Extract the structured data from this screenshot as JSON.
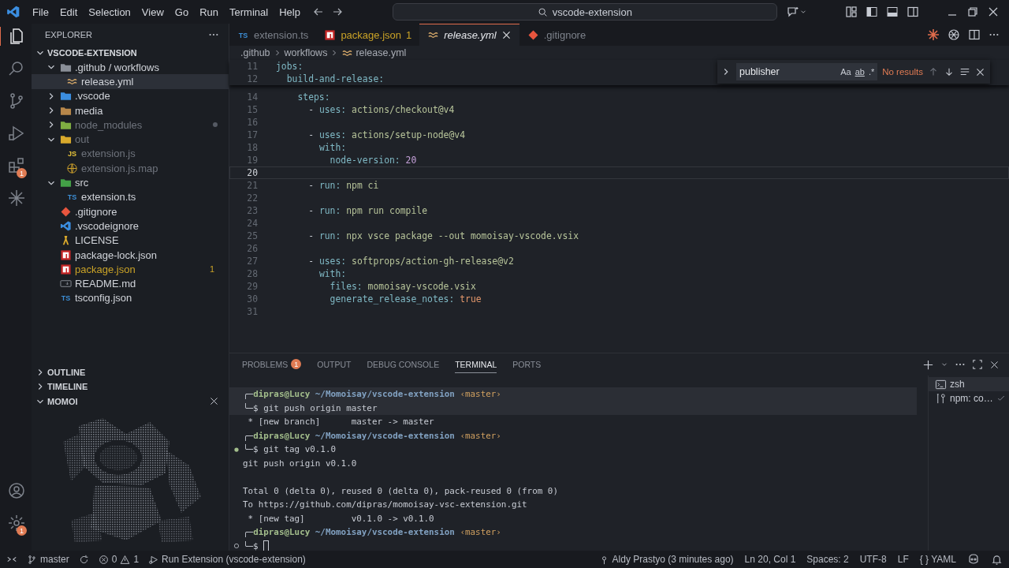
{
  "title_bar": {
    "menus": [
      "File",
      "Edit",
      "Selection",
      "View",
      "Go",
      "Run",
      "Terminal",
      "Help"
    ],
    "command_center": "vscode-extension"
  },
  "activity_bar": {
    "items": [
      {
        "kind": "explorer",
        "selected": true
      },
      {
        "kind": "search",
        "selected": false
      },
      {
        "kind": "source-control",
        "selected": false
      },
      {
        "kind": "run",
        "selected": false
      },
      {
        "kind": "extensions",
        "selected": false,
        "badge": "1"
      },
      {
        "kind": "sparkle",
        "selected": false
      }
    ],
    "bottom": [
      {
        "kind": "account"
      },
      {
        "kind": "settings",
        "badge": "1"
      }
    ]
  },
  "sidebar": {
    "title": "EXPLORER",
    "root": {
      "label": "VSCODE-EXTENSION",
      "expanded": true,
      "children": [
        {
          "label": ".github / workflows",
          "kind": "folder-github",
          "expanded": true,
          "selected": false,
          "ignored": false,
          "warning": false,
          "children": [
            {
              "label": "release.yml",
              "kind": "yaml",
              "selected": true,
              "ignored": false,
              "warning": false
            }
          ]
        },
        {
          "label": ".vscode",
          "kind": "folder-vscode",
          "expanded": false,
          "selected": false,
          "ignored": false,
          "warning": false
        },
        {
          "label": "media",
          "kind": "folder",
          "expanded": false,
          "selected": false,
          "ignored": false,
          "warning": false
        },
        {
          "label": "node_modules",
          "kind": "folder-node",
          "expanded": false,
          "selected": false,
          "ignored": true,
          "warning": false
        },
        {
          "label": "out",
          "kind": "folder-out",
          "expanded": true,
          "selected": false,
          "ignored": true,
          "warning": false,
          "children": [
            {
              "label": "extension.js",
              "kind": "js",
              "icon_text": "JS",
              "selected": false,
              "ignored": true,
              "warning": false
            },
            {
              "label": "extension.js.map",
              "kind": "globe",
              "selected": false,
              "ignored": true,
              "warning": false
            }
          ]
        },
        {
          "label": "src",
          "kind": "folder-src",
          "expanded": true,
          "selected": false,
          "ignored": false,
          "warning": false,
          "children": [
            {
              "label": "extension.ts",
              "kind": "ts",
              "icon_text": "TS",
              "selected": false,
              "ignored": false,
              "warning": false
            }
          ]
        },
        {
          "label": ".gitignore",
          "kind": "git",
          "selected": false,
          "ignored": false,
          "warning": false
        },
        {
          "label": ".vscodeignore",
          "kind": "vscode",
          "selected": false,
          "ignored": false,
          "warning": false
        },
        {
          "label": "LICENSE",
          "kind": "license",
          "selected": false,
          "ignored": false,
          "warning": false
        },
        {
          "label": "package-lock.json",
          "kind": "npm",
          "selected": false,
          "ignored": false,
          "warning": false
        },
        {
          "label": "package.json",
          "kind": "npm",
          "selected": false,
          "ignored": false,
          "warning": true,
          "badge": "1"
        },
        {
          "label": "README.md",
          "kind": "markdown",
          "selected": false,
          "ignored": false,
          "warning": false
        },
        {
          "label": "tsconfig.json",
          "kind": "tsconfig",
          "icon_text": "TS",
          "selected": false,
          "ignored": false,
          "warning": false
        }
      ]
    },
    "sections": [
      {
        "label": "OUTLINE",
        "expanded": false
      },
      {
        "label": "TIMELINE",
        "expanded": false
      },
      {
        "label": "MOMOI",
        "expanded": true
      }
    ]
  },
  "editor": {
    "tabs": [
      {
        "label": "extension.ts",
        "kind": "ts",
        "icon_text": "TS",
        "selected": false,
        "preview": false,
        "warning": false
      },
      {
        "label": "package.json",
        "kind": "npm",
        "selected": false,
        "preview": false,
        "warning": true,
        "badge": "1"
      },
      {
        "label": "release.yml",
        "kind": "yaml",
        "selected": true,
        "preview": true,
        "warning": false
      },
      {
        "label": ".gitignore",
        "kind": "git",
        "selected": false,
        "preview": false,
        "warning": false
      }
    ],
    "breadcrumbs": [
      ".github",
      "workflows",
      "release.yml"
    ],
    "sticky_lines": [
      {
        "number": "11",
        "key": "jobs:",
        "children": [
          {
            "number": "12",
            "key": "build-and-release:"
          }
        ]
      }
    ],
    "lines": [
      {
        "number": "14",
        "key": "steps:",
        "current": false,
        "children": [
          {
            "number": "15",
            "prefix": "-",
            "key": "uses:",
            "value": "actions/checkout@v4",
            "kind": "string",
            "current": false
          },
          {
            "number": "16",
            "current": false
          },
          {
            "number": "17",
            "prefix": "-",
            "key": "uses:",
            "value": "actions/setup-node@v4",
            "kind": "string",
            "current": false,
            "children": [
              {
                "number": "18",
                "key": "with:",
                "current": false,
                "children": [
                  {
                    "number": "19",
                    "key": "node-version:",
                    "value": "20",
                    "kind": "number",
                    "current": false
                  }
                ]
              }
            ]
          },
          {
            "number": "20",
            "current": true
          },
          {
            "number": "21",
            "prefix": "-",
            "key": "run:",
            "value": "npm ci",
            "kind": "string",
            "current": false
          },
          {
            "number": "22",
            "current": false
          },
          {
            "number": "23",
            "prefix": "-",
            "key": "run:",
            "value": "npm run compile",
            "kind": "string",
            "current": false
          },
          {
            "number": "24",
            "current": false
          },
          {
            "number": "25",
            "prefix": "-",
            "key": "run:",
            "value": "npx vsce package --out momoisay-vscode.vsix",
            "kind": "string",
            "current": false
          },
          {
            "number": "26",
            "current": false
          },
          {
            "number": "27",
            "prefix": "-",
            "key": "uses:",
            "value": "softprops/action-gh-release@v2",
            "kind": "string",
            "current": false,
            "children": [
              {
                "number": "28",
                "key": "with:",
                "current": false,
                "children": [
                  {
                    "number": "29",
                    "key": "files:",
                    "value": "momoisay-vscode.vsix",
                    "kind": "string",
                    "current": false
                  },
                  {
                    "number": "30",
                    "key": "generate_release_notes:",
                    "value": "true",
                    "kind": "boolean",
                    "current": false
                  }
                ]
              }
            ]
          }
        ]
      },
      {
        "number": "31",
        "current": false
      }
    ],
    "find": {
      "value": "publisher",
      "options": [
        "Aa",
        "ab",
        ".*"
      ],
      "status": "No results"
    }
  },
  "panel": {
    "tabs": [
      {
        "label": "PROBLEMS",
        "badge": "1",
        "selected": false
      },
      {
        "label": "OUTPUT",
        "selected": false
      },
      {
        "label": "DEBUG CONSOLE",
        "selected": false
      },
      {
        "label": "TERMINAL",
        "selected": true
      },
      {
        "label": "PORTS",
        "selected": false
      }
    ],
    "terminal": {
      "lines": [
        {
          "kind": "prompt",
          "corner": "╭─",
          "user": "dipras@Lucy",
          "path": "~/Momoisay/vscode-extension",
          "branch": "‹master›",
          "hovered": true
        },
        {
          "kind": "command",
          "corner": "╰─$",
          "text": "git push origin master",
          "decorated": false,
          "hovered": true
        },
        {
          "kind": "output",
          "text": " * [new branch]      master -> master",
          "hovered": false
        },
        {
          "kind": "prompt",
          "corner": "╭─",
          "user": "dipras@Lucy",
          "path": "~/Momoisay/vscode-extension",
          "branch": "‹master›",
          "hovered": false
        },
        {
          "kind": "command",
          "corner": "╰─$",
          "text": "git tag v0.1.0",
          "decorated": true,
          "succeeded": true,
          "hovered": false
        },
        {
          "kind": "output",
          "text": "git push origin v0.1.0",
          "hovered": false
        },
        {
          "kind": "blank",
          "hovered": false
        },
        {
          "kind": "output",
          "text": "Total 0 (delta 0), reused 0 (delta 0), pack-reused 0 (from 0)",
          "hovered": false
        },
        {
          "kind": "output",
          "text": "To https://github.com/dipras/momoisay-vsc-extension.git",
          "hovered": false
        },
        {
          "kind": "output",
          "text": " * [new tag]         v0.1.0 -> v0.1.0",
          "hovered": false
        },
        {
          "kind": "prompt",
          "corner": "╭─",
          "user": "dipras@Lucy",
          "path": "~/Momoisay/vscode-extension",
          "branch": "‹master›",
          "hovered": false
        },
        {
          "kind": "command",
          "corner": "╰─$",
          "decorated": true,
          "succeeded": false,
          "cursor": true,
          "hovered": false
        }
      ]
    },
    "terminals": [
      {
        "label": "zsh",
        "kind": "terminal",
        "selected": true,
        "done": false
      },
      {
        "label": "npm: co…",
        "kind": "tools",
        "selected": false,
        "done": true
      }
    ]
  },
  "status_bar": {
    "branch": "master",
    "errors": "0",
    "warnings": "1",
    "launch": "Run Extension (vscode-extension)",
    "blame": "Aldy Prastyo (3 minutes ago)",
    "position": "Ln 20, Col 1",
    "indent": "Spaces: 2",
    "encoding": "UTF-8",
    "eol": "LF",
    "language_icon": "{ }",
    "language": "YAML"
  }
}
